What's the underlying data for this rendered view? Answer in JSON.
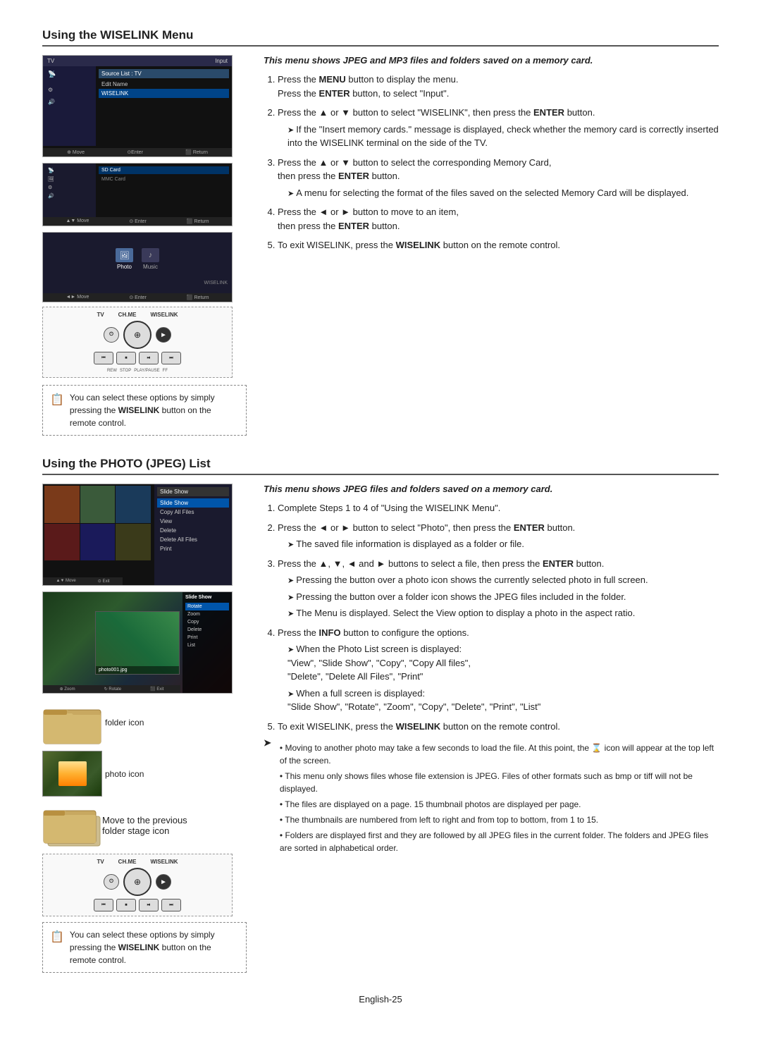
{
  "page": {
    "page_number": "English-25"
  },
  "section1": {
    "title": "Using the WISELINK Menu",
    "italic_intro": "This menu shows JPEG and MP3 files and folders saved on a memory card.",
    "steps": [
      {
        "num": 1,
        "text": "Press the ",
        "bold": "MENU",
        "text2": " button to display the menu.",
        "sub": "Press the ",
        "sub_bold": "ENTER",
        "sub2": " button, to select \"Input\"."
      },
      {
        "num": 2,
        "text": "Press the ▲ or ▼ button to select \"WISELINK\", then press the ",
        "bold": "ENTER",
        "text2": " button.",
        "sub_items": [
          "If the \"Insert memory cards.\" message is displayed, check whether the memory card is correctly inserted into the WISELINK terminal on the side of the TV."
        ]
      },
      {
        "num": 3,
        "text": "Press the ▲ or ▼ button to select the corresponding Memory Card, then press the ",
        "bold": "ENTER",
        "text2": " button.",
        "sub_items": [
          "A menu for selecting the format of the files saved on the selected Memory Card will be displayed."
        ]
      },
      {
        "num": 4,
        "text": "Press the ◄ or ► button to move to an item, then press the ",
        "bold": "ENTER",
        "text2": " button."
      },
      {
        "num": 5,
        "text": "To exit WISELINK, press the ",
        "bold": "WISELINK",
        "text2": " button on the remote control."
      }
    ],
    "note": "You can select these options by simply pressing the WISELINK button on the remote control."
  },
  "section2": {
    "title": "Using the PHOTO (JPEG) List",
    "italic_intro": "This menu shows JPEG files and folders saved on a memory card.",
    "steps": [
      {
        "num": 1,
        "text": "Complete Steps 1 to 4 of \"Using the WISELINK Menu\"."
      },
      {
        "num": 2,
        "text": "Press the ◄ or ► button to select \"Photo\", then press the ",
        "bold": "ENTER",
        "text2": " button.",
        "sub_items": [
          "The saved file information is displayed as a folder or file."
        ]
      },
      {
        "num": 3,
        "text": "Press the ▲, ▼, ◄ and ► buttons to select a file, then press the ",
        "bold": "ENTER",
        "text2": " button.",
        "sub_items": [
          "Pressing the button over a photo icon shows the currently selected photo in full screen.",
          "Pressing the button over a folder icon shows the JPEG files included in the folder.",
          "The Menu is displayed. Select the View option to display a photo in the aspect ratio."
        ]
      },
      {
        "num": 4,
        "text": "Press the ",
        "bold": "INFO",
        "text2": " button to configure the options.",
        "sub_items": [
          "When the Photo List screen is displayed: \"View\", \"Slide Show\", \"Copy\", \"Copy All files\", \"Delete\", \"Delete All Files\", \"Print\"",
          "When a full screen is displayed: \"Slide Show\", \"Rotate\", \"Zoom\", \"Copy\", \"Delete\", \"Print\", \"List\""
        ]
      },
      {
        "num": 5,
        "text": "To exit WISELINK, press the ",
        "bold": "WISELINK",
        "text2": " button on the remote control."
      }
    ],
    "arrow_note": "• Moving to another photo may take a few seconds to load the file. At this point, the ⌛ icon will appear at the top left of the screen.\n• This menu only shows files whose file extension is JPEG. Files of other formats such as bmp or tiff will not be displayed.\n• The files are displayed on a page. 15 thumbnail photos are displayed per page.\n• The thumbnails are numbered from left to right and from top to bottom, from 1 to 15.\n• Folders are displayed first and they are followed by all JPEG files in the current folder. The folders and JPEG files are sorted in alphabetical order.",
    "icons": {
      "folder_label": "folder icon",
      "photo_label": "photo icon",
      "folder_stage_label": "folder stage icon",
      "folder_stage_desc": "Move to the previous"
    },
    "note": "You can select these options by simply pressing the WISELINK button on the remote control."
  },
  "ui": {
    "tv_header_left": "TV",
    "tv_header_right": "Input",
    "menu_items": [
      "Source List : TV",
      "Edit Name",
      "WISELINK"
    ],
    "bottombar": [
      "◄ Move",
      "⊙Enter",
      "⬛ Return"
    ],
    "wiselink_label": "WISELINK",
    "tv_label": "TV",
    "ch_me_label": "CH.ME",
    "rew_label": "REW",
    "stop_label": "STOP",
    "play_pause_label": "PLAY/PAUSE",
    "ff_label": "FF"
  }
}
